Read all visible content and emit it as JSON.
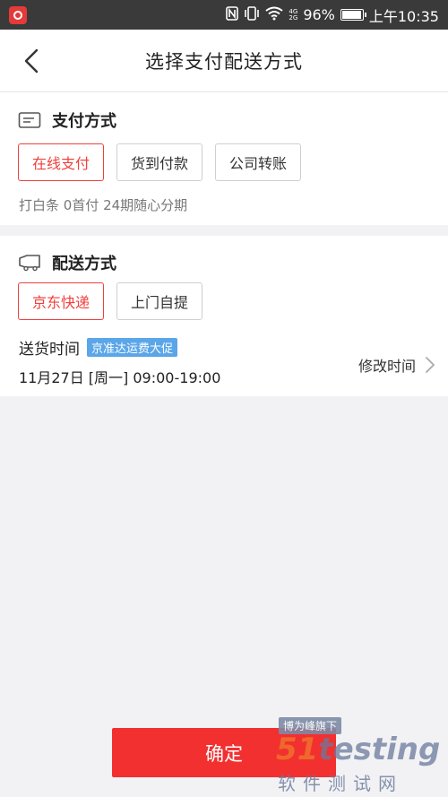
{
  "status_bar": {
    "battery_text": "96%",
    "time_text": "上午10:35",
    "battery_level": 0.96,
    "icons": [
      "app-icon",
      "nfc-icon",
      "vibrate-icon",
      "wifi-icon",
      "signal-icon",
      "battery-icon"
    ],
    "signal_label_top": "4G",
    "signal_label_bottom": "2G"
  },
  "header": {
    "title": "选择支付配送方式",
    "back_icon": "chevron-left-icon"
  },
  "payment": {
    "title": "支付方式",
    "icon": "card-icon",
    "options": [
      {
        "label": "在线支付",
        "selected": true
      },
      {
        "label": "货到付款",
        "selected": false
      },
      {
        "label": "公司转账",
        "selected": false
      }
    ],
    "hint": "打白条 0首付 24期随心分期"
  },
  "shipping": {
    "title": "配送方式",
    "icon": "truck-icon",
    "options": [
      {
        "label": "京东快递",
        "selected": true
      },
      {
        "label": "上门自提",
        "selected": false
      }
    ],
    "delivery_label": "送货时间",
    "promo_badge": "京准达运费大促",
    "delivery_time": "11月27日 [周一] 09:00-19:00",
    "modify_label": "修改时间"
  },
  "footer": {
    "confirm_label": "确定"
  },
  "watermark": {
    "tag": "博为峰旗下",
    "logo_prefix": "51",
    "logo_main": "testing",
    "subtitle": "软件测试网"
  },
  "colors": {
    "accent": "#f23030",
    "selected_border": "#f0403c",
    "badge": "#5aa6e8",
    "background": "#f2f2f4"
  }
}
